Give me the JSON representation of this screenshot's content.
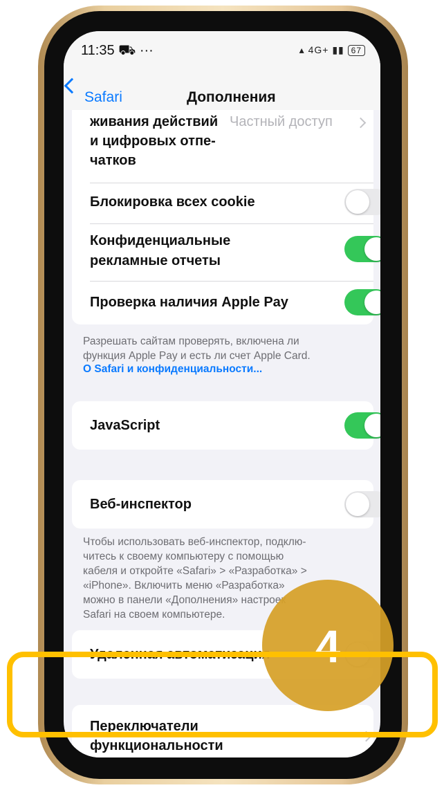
{
  "status_bar": {
    "time": "11:35",
    "extra_icons": "⛟ ···",
    "network": "4G+",
    "battery": "67"
  },
  "nav": {
    "back_label": "Safari",
    "title": "Дополнения"
  },
  "tracking_row": {
    "label_lines": [
      "живания действий",
      "и цифровых отпе-",
      "чатков"
    ],
    "value": "Частный доступ"
  },
  "block_cookies": {
    "label": "Блокировка всех cookie",
    "state": "off"
  },
  "ad_reports": {
    "label_lines": [
      "Конфиденциальные",
      "рекламные отчеты"
    ],
    "state": "on"
  },
  "apple_pay": {
    "label": "Проверка наличия Apple Pay",
    "state": "on"
  },
  "apple_pay_note": {
    "lines": [
      "Разрешать сайтам проверять, включена ли",
      "функция Apple Pay и есть ли счет Apple Card."
    ],
    "link": "О Safari и конфиденциальности..."
  },
  "javascript": {
    "label": "JavaScript",
    "state": "on"
  },
  "web_inspector": {
    "label": "Веб-инспектор",
    "state": "off"
  },
  "web_inspector_note": {
    "lines": [
      "Чтобы использовать веб-инспектор, подклю-",
      "читесь к своему компьютеру с помощью",
      "кабеля и откройте «Safari» > «Разработка» >",
      "«iPhone». Включить меню «Разработка»",
      "можно в панели «Дополнения» настроек",
      "Safari на своем компьютере."
    ]
  },
  "remote_automation": {
    "label": "Удаленная автоматизация",
    "state": "off"
  },
  "feature_flags": {
    "label_lines": [
      "Переключатели",
      "функциональности"
    ]
  },
  "annotation": {
    "step_number": "4",
    "circle_color": "#d6a028",
    "highlight_color": "#ffc000"
  },
  "colors": {
    "toggle_on": "#34c759",
    "toggle_off": "#e9e9eb",
    "accent": "#0a7aff"
  }
}
